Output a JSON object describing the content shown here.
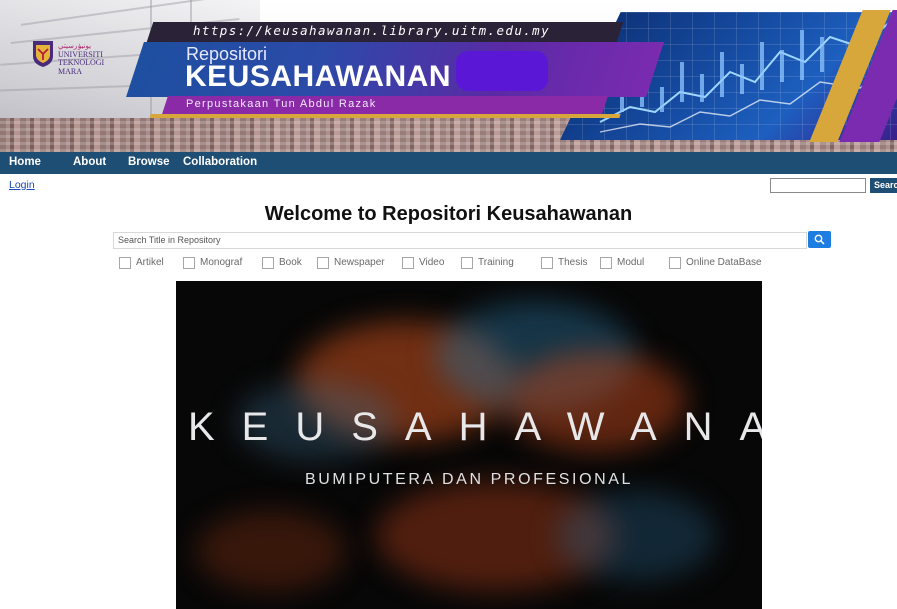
{
  "banner": {
    "url": "https://keusahawanan.library.uitm.edu.my",
    "title_small": "Repositori",
    "title_big": "KEUSAHAWANAN",
    "subtitle": "Perpustakaan Tun Abdul Razak",
    "logo": {
      "jawi": "يونيۏرسيتي",
      "line1": "UNIVERSITI",
      "line2": "TEKNOLOGI",
      "line3": "MARA"
    }
  },
  "nav": {
    "items": [
      "Home",
      "About",
      "Browse",
      "Collaboration"
    ]
  },
  "login_label": "Login",
  "top_search": {
    "value": "",
    "button_label": "Search"
  },
  "main": {
    "heading": "Welcome to Repositori Keusahawanan",
    "search_placeholder": "Search Title in Repository",
    "filters": [
      "Artikel",
      "Monograf",
      "Book",
      "Newspaper",
      "Video",
      "Training",
      "Thesis",
      "Modul",
      "Online DataBase"
    ]
  },
  "video": {
    "title": "KEUSAHAWANAN",
    "subtitle": "BUMIPUTERA DAN PROFESIONAL"
  },
  "colors": {
    "nav_bg": "#1f4e74",
    "search_button": "#1e7de0",
    "banner_purple": "#7a2bb0",
    "banner_blue": "#1e4fa0",
    "accent_gold": "#d7a73c"
  }
}
